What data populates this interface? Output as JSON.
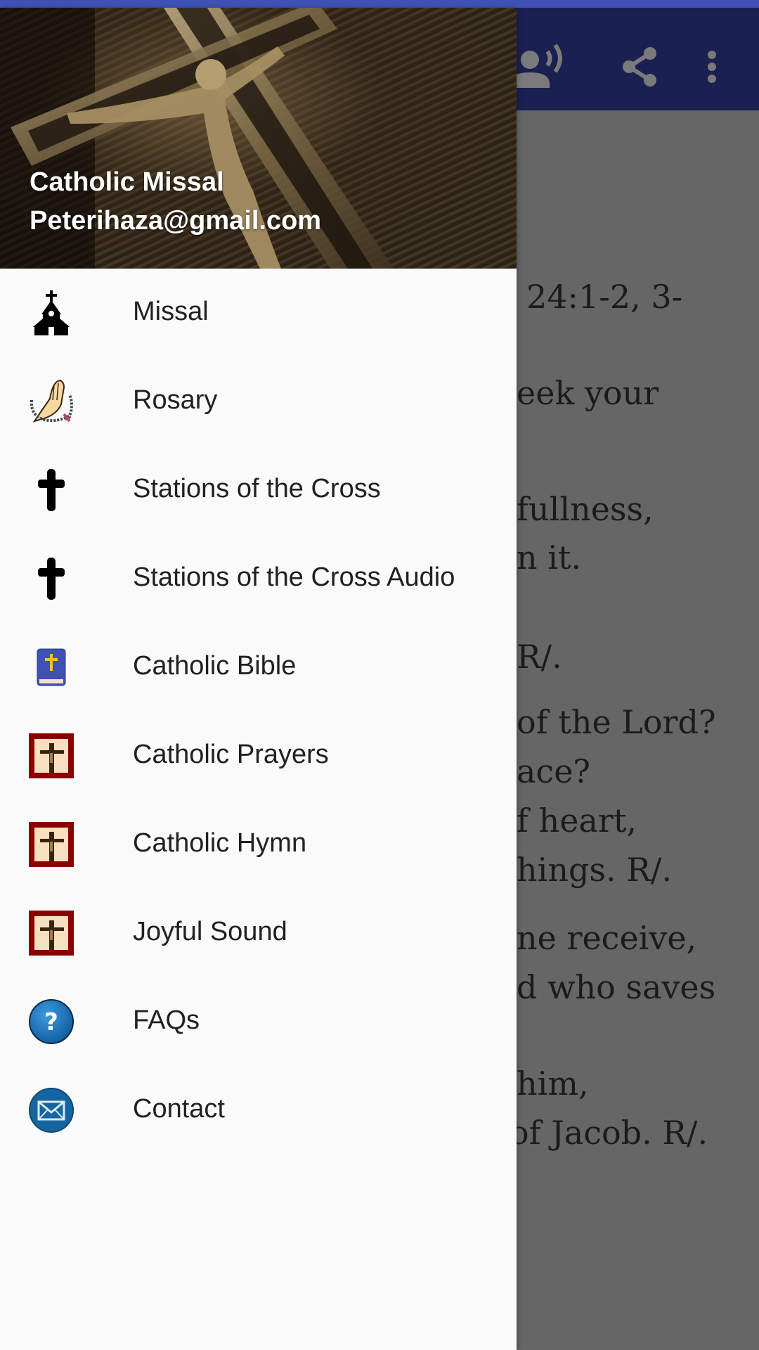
{
  "colors": {
    "status_bar": "#3f51b5",
    "toolbar": "#1a2050",
    "scrim_content": "#666666",
    "drawer_bg": "#fafafa",
    "menu_text": "#212121",
    "bible_blue": "#3f51b5",
    "frame_red": "#8b0000"
  },
  "toolbar": {
    "icons": [
      {
        "name": "text-to-speech-icon"
      },
      {
        "name": "share-icon"
      },
      {
        "name": "more-options-icon"
      }
    ]
  },
  "drawer": {
    "header": {
      "title": "Catholic Missal",
      "email": "Peterihaza@gmail.com"
    },
    "items": [
      {
        "label": "Missal",
        "icon": "church-icon"
      },
      {
        "label": "Rosary",
        "icon": "praying-hands-rosary-icon"
      },
      {
        "label": "Stations of the Cross",
        "icon": "cross-icon"
      },
      {
        "label": "Stations of the Cross Audio",
        "icon": "cross-icon"
      },
      {
        "label": "Catholic Bible",
        "icon": "bible-icon"
      },
      {
        "label": "Catholic Prayers",
        "icon": "crucifix-frame-icon"
      },
      {
        "label": "Catholic Hymn",
        "icon": "crucifix-frame-icon"
      },
      {
        "label": "Joyful Sound",
        "icon": "crucifix-frame-icon"
      },
      {
        "label": "FAQs",
        "icon": "help-icon"
      },
      {
        "label": "Contact",
        "icon": "mail-icon"
      }
    ]
  },
  "content": {
    "visible_lines": [
      "24:1-2, 3-",
      "eek your",
      "fullness,",
      "n it.",
      "R/.",
      "of the Lord?",
      "ace?",
      "f heart,",
      "hings. R/.",
      "ne receive,",
      "d who saves",
      "him,",
      "of Jacob. R/."
    ]
  }
}
